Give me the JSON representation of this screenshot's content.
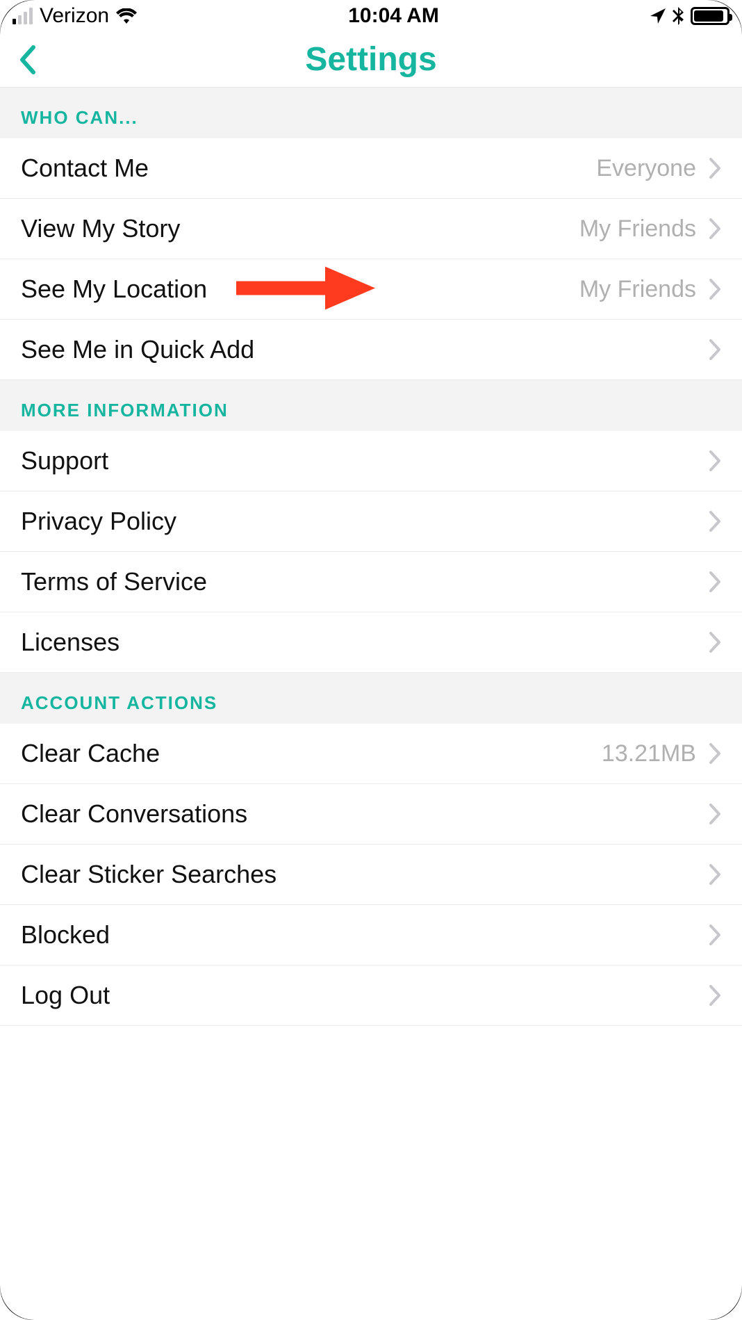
{
  "status_bar": {
    "carrier": "Verizon",
    "time": "10:04 AM"
  },
  "header": {
    "title": "Settings"
  },
  "sections": {
    "who_can": {
      "header": "WHO CAN...",
      "items": [
        {
          "label": "Contact Me",
          "value": "Everyone"
        },
        {
          "label": "View My Story",
          "value": "My Friends"
        },
        {
          "label": "See My Location",
          "value": "My Friends"
        },
        {
          "label": "See Me in Quick Add",
          "value": ""
        }
      ]
    },
    "more_info": {
      "header": "MORE INFORMATION",
      "items": [
        {
          "label": "Support",
          "value": ""
        },
        {
          "label": "Privacy Policy",
          "value": ""
        },
        {
          "label": "Terms of Service",
          "value": ""
        },
        {
          "label": "Licenses",
          "value": ""
        }
      ]
    },
    "account_actions": {
      "header": "ACCOUNT ACTIONS",
      "items": [
        {
          "label": "Clear Cache",
          "value": "13.21MB"
        },
        {
          "label": "Clear Conversations",
          "value": ""
        },
        {
          "label": "Clear Sticker Searches",
          "value": ""
        },
        {
          "label": "Blocked",
          "value": ""
        },
        {
          "label": "Log Out",
          "value": ""
        }
      ]
    }
  }
}
